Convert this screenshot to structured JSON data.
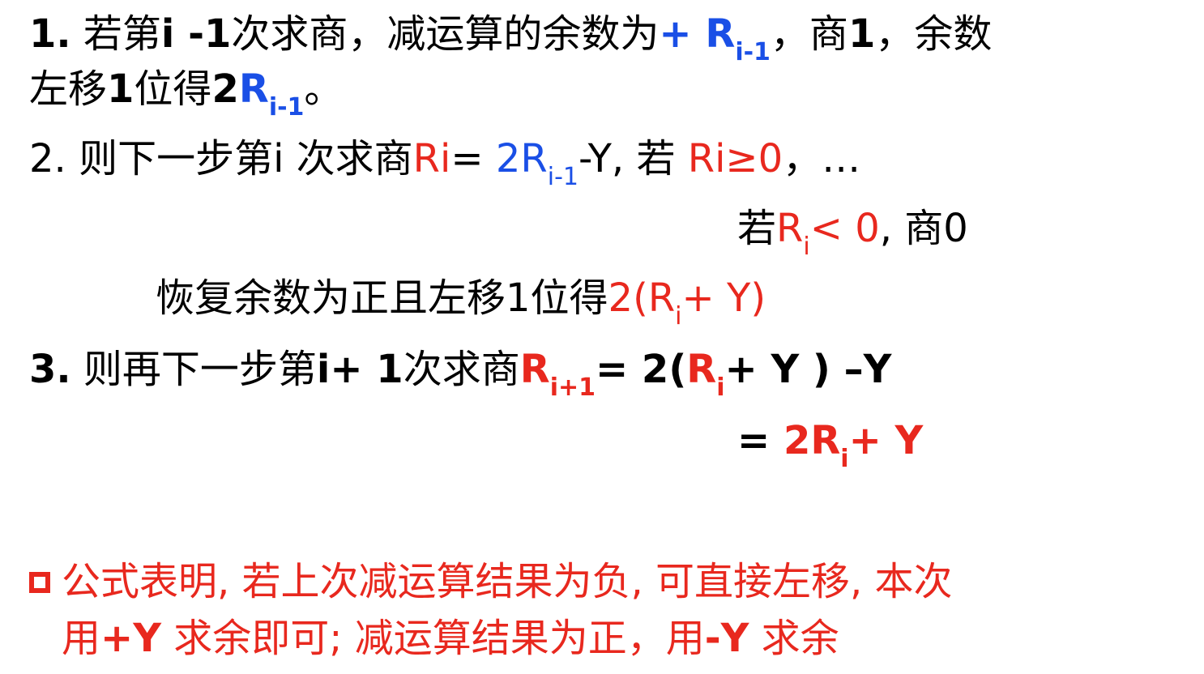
{
  "colors": {
    "black": "#000000",
    "blue": "#1a4fe6",
    "red": "#e8281e"
  },
  "step1": {
    "line1": {
      "num": "1.",
      "t1": "若第",
      "t2": "i -1",
      "t3": "次求商，减运算的余数为",
      "expr_main": "+ R",
      "expr_sub": "i-1",
      "t4": "，商",
      "t5": "1",
      "t6": "，余数"
    },
    "line2": {
      "t1": "左移",
      "t2": "1",
      "t3": "位得",
      "t4": "2",
      "r_main": "R",
      "r_sub": "i-1",
      "t5": "。"
    }
  },
  "step2": {
    "line1": {
      "num": "2.",
      "t1": "则下一步第i 次求商",
      "t2": "Ri",
      "t3": "= ",
      "t4_main": "2R",
      "t4_sub": "i-1",
      "t5": "-Y, 若 ",
      "t6": "Ri≥0",
      "t7": "，…"
    },
    "line2": {
      "t1": "若",
      "t2_main": "R",
      "t2_sub": "i",
      "t3": "< 0",
      "t4": ", 商0"
    },
    "line3": {
      "t1": "恢复余数为正且左移1位得",
      "t2": "2(R",
      "t2_sub": "i",
      "t3": "+ Y)"
    }
  },
  "step3": {
    "line1": {
      "num": "3.",
      "t1": "则再下一步第",
      "t2": "i+ 1",
      "t3": "次求商",
      "r_main": "R",
      "r_sub": "i+1",
      "t4": "= 2(",
      "t5_main": "R",
      "t5_sub": "i",
      "t6": "+ Y ) –Y"
    },
    "line2": {
      "t1": "= ",
      "t2_main": "2R",
      "t2_sub": "i",
      "t3": "+ Y"
    }
  },
  "note": {
    "line1": "公式表明, 若上次减运算结果为负, 可直接左移, 本次",
    "line2_a": "用",
    "line2_b": "+Y",
    "line2_c": " 求余即可; 减运算结果为正，用",
    "line2_d": "-Y",
    "line2_e": " 求余"
  }
}
